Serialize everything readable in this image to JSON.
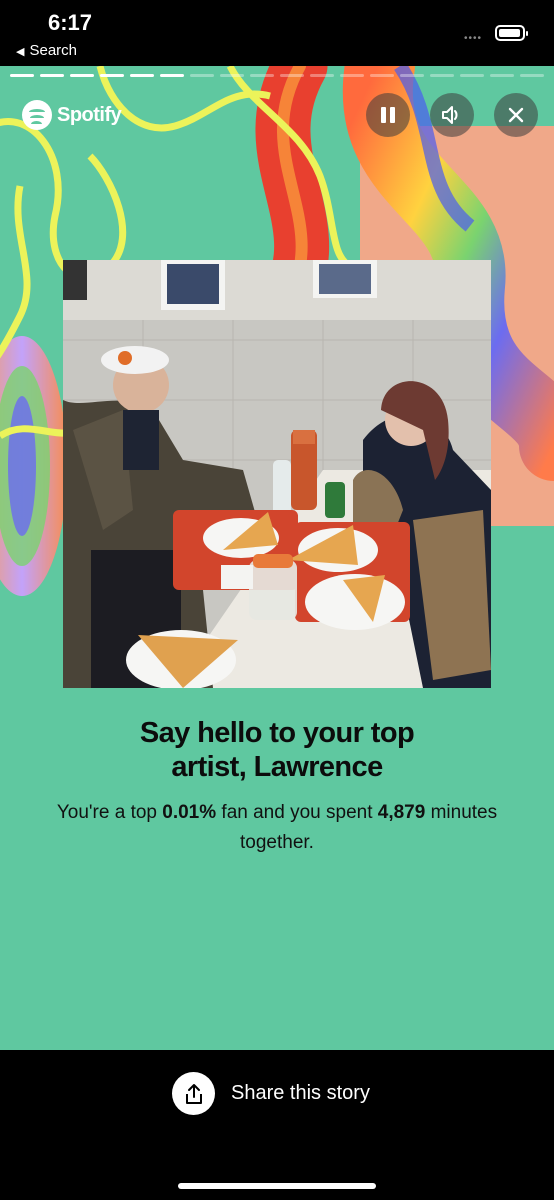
{
  "status_bar": {
    "time": "6:17",
    "back_label": "Search",
    "signal_dots": "••••"
  },
  "story": {
    "brand_name": "Spotify",
    "segments_total": 18,
    "segments_done": 6,
    "headline_line1": "Say hello to your top",
    "headline_line2": "artist, Lawrence",
    "body": {
      "part1": "You're a top ",
      "percent": "0.01%",
      "part2": " fan and you spent ",
      "minutes": "4,879",
      "part3": " minutes together."
    },
    "background_color": "#5fc8a0"
  },
  "controls": {
    "pause_icon": "pause-icon",
    "sound_icon": "speaker-icon",
    "close_icon": "close-icon"
  },
  "share": {
    "label": "Share this story",
    "icon": "share-icon"
  }
}
